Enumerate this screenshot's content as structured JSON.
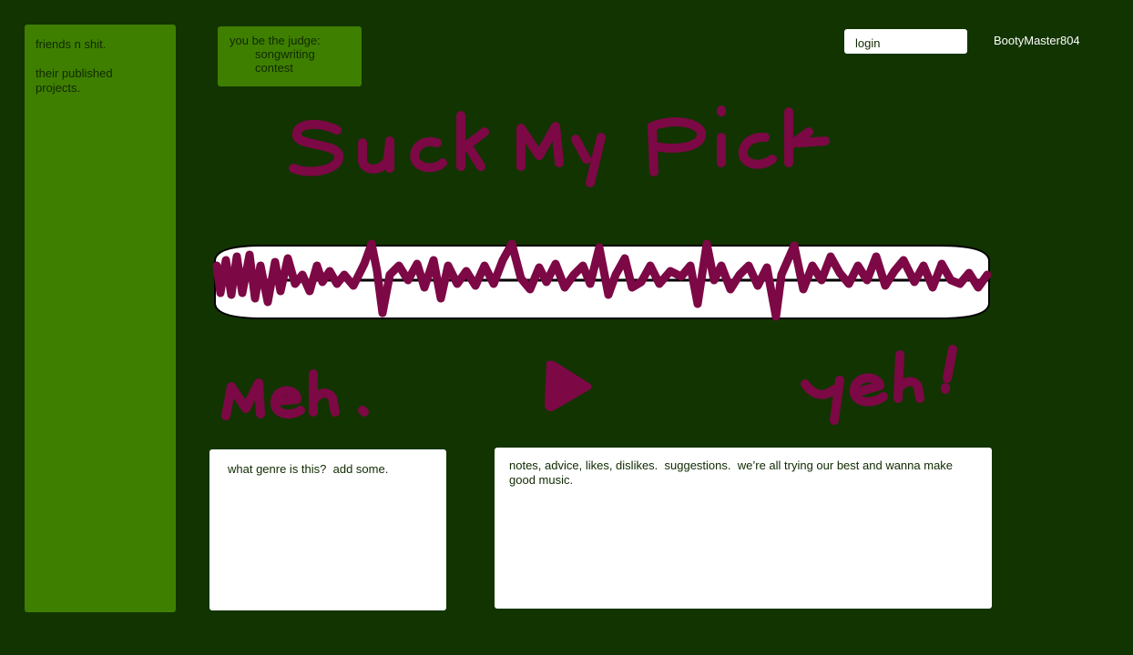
{
  "colors": {
    "background": "#123401",
    "panel_green": "#3f7f00",
    "scribble_magenta": "#7c0845",
    "panel_text": "#0f2a00"
  },
  "sidebar": {
    "items": [
      {
        "label": "friends n shit."
      },
      {
        "label": "their published\nprojects."
      }
    ]
  },
  "contest_card": {
    "title": "you be the judge:",
    "subtitle": "songwriting\ncontest"
  },
  "header": {
    "login_placeholder": "login",
    "username": "BootyMaster804"
  },
  "handwriting": {
    "headline": "Suck My Pick",
    "rating_low": "Meh.",
    "rating_high": "yeh!"
  },
  "player": {
    "waveform_icon": "waveform-scribble",
    "play_icon": "play-triangle-icon"
  },
  "genre_box": {
    "placeholder": "what genre is this?  add some."
  },
  "notes_box": {
    "placeholder": "notes, advice, likes, dislikes.  suggestions.  we’re all trying our best and wanna make good music."
  }
}
